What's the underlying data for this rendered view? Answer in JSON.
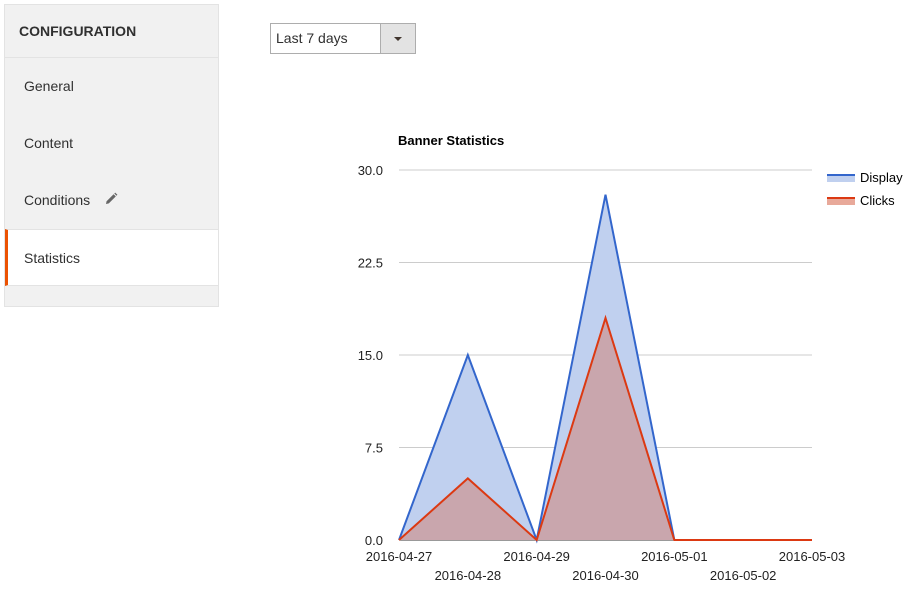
{
  "sidebar": {
    "title": "CONFIGURATION",
    "items": [
      {
        "label": "General"
      },
      {
        "label": "Content"
      },
      {
        "label": "Conditions",
        "icon": "pencil-icon"
      },
      {
        "label": "Statistics",
        "active": true
      }
    ]
  },
  "date_range": {
    "selected": "Last 7 days"
  },
  "colors": {
    "accent": "#eb5202",
    "display_line": "#3366cc",
    "display_fill": "#c0d0ef",
    "clicks_line": "#dc3912",
    "clicks_fill": "#c9a3a9"
  },
  "chart_data": {
    "type": "area",
    "title": "Banner Statistics",
    "x": [
      "2016-04-27",
      "2016-04-28",
      "2016-04-29",
      "2016-04-30",
      "2016-05-01",
      "2016-05-02",
      "2016-05-03"
    ],
    "series": [
      {
        "name": "Display",
        "values": [
          0,
          15,
          0,
          28,
          0,
          0,
          0
        ]
      },
      {
        "name": "Clicks",
        "values": [
          0,
          5,
          0,
          18,
          0,
          0,
          0
        ]
      }
    ],
    "ylim": [
      0,
      30
    ],
    "yticks": [
      "0.0",
      "7.5",
      "15.0",
      "22.5",
      "30.0"
    ],
    "grid": true,
    "legend": "right"
  }
}
